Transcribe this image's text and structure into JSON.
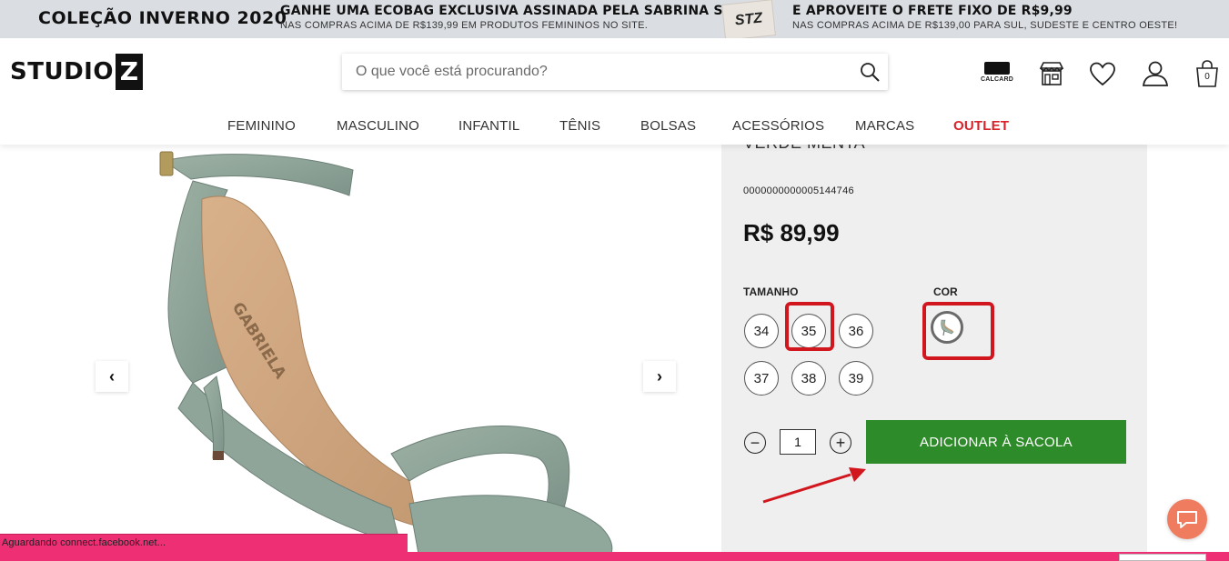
{
  "promo": {
    "collection": "COLEÇÃO INVERNO 2020",
    "offer1_title": "GANHE UMA ECOBAG EXCLUSIVA ASSINADA PELA SABRINA SATO",
    "offer1_subtitle": "NAS COMPRAS ACIMA DE R$139,99 EM PRODUTOS FEMININOS NO SITE.",
    "bag_label": "STZ",
    "offer2_title": "E APROVEITE O FRETE FIXO DE R$9,99",
    "offer2_subtitle": "NAS COMPRAS ACIMA DE R$139,00 PARA SUL, SUDESTE E CENTRO OESTE!"
  },
  "header": {
    "logo_text": "STUDIO",
    "logo_mark": "Z",
    "search_placeholder": "O que você está procurando?",
    "calcard_label": "CALCARD",
    "cart_count": "0",
    "icons": [
      "search-icon",
      "calcard-icon",
      "store-icon",
      "heart-icon",
      "user-icon",
      "shopping-bag-icon"
    ]
  },
  "nav": {
    "items": [
      "FEMININO",
      "MASCULINO",
      "INFANTIL",
      "TÊNIS",
      "BOLSAS",
      "ACESSÓRIOS",
      "MARCAS",
      "OUTLET"
    ],
    "outlet_color": "#d8232a"
  },
  "gallery": {
    "prev_arrow": "‹",
    "next_arrow": "›",
    "insole_brand": "GABRIELA"
  },
  "product": {
    "name": "VERDE MENTA",
    "sku": "0000000000005144746",
    "price": "R$ 89,99",
    "size_label": "TAMANHO",
    "color_label": "COR",
    "sizes": [
      "34",
      "35",
      "36",
      "37",
      "38",
      "39"
    ],
    "selected_size": "35",
    "quantity": "1",
    "minus": "−",
    "plus": "+",
    "add_to_bag": "ADICIONAR À SACOLA",
    "add_button_color": "#2e8b2a",
    "highlight_color": "#d2161e"
  },
  "status": {
    "text": "Aguardando connect.facebook.net...",
    "bar_color": "#ee2f74"
  }
}
